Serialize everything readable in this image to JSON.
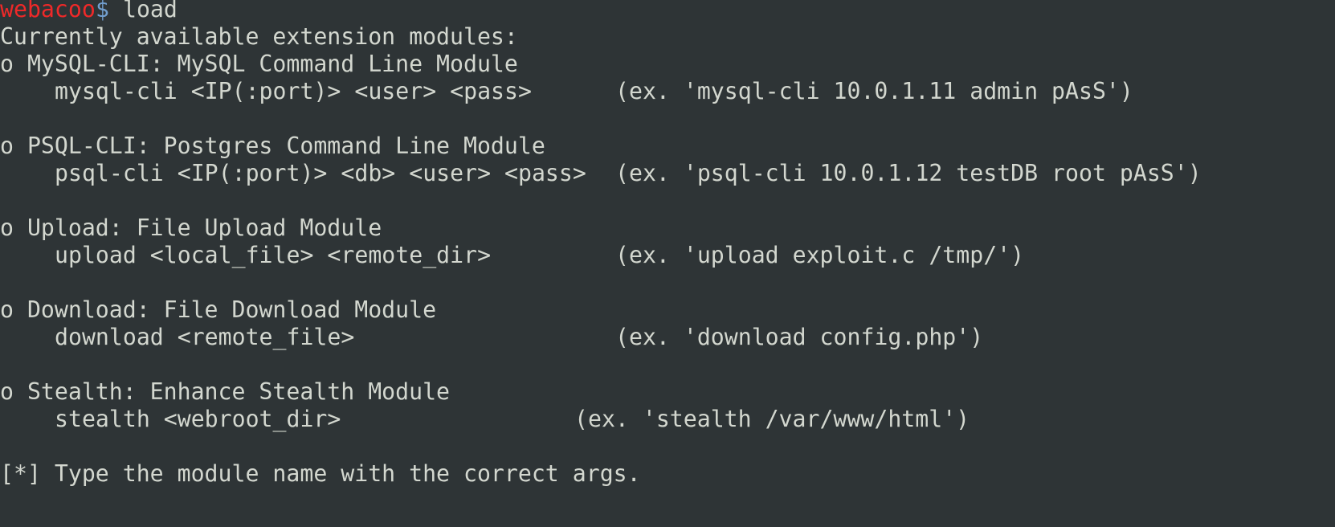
{
  "colors": {
    "background": "#2e3436",
    "foreground": "#d3d7cf",
    "prompt_host": "#ef2929",
    "prompt_symbol": "#729fcf"
  },
  "prompt": {
    "host": "webacoo",
    "symbol": "$",
    "command": " load"
  },
  "header": "Currently available extension modules:",
  "modules": [
    {
      "title": "o MySQL-CLI: MySQL Command Line Module",
      "usage": "mysql-cli <IP(:port)> <user> <pass>",
      "example": "(ex. 'mysql-cli 10.0.1.11 admin pAsS')"
    },
    {
      "title": "o PSQL-CLI: Postgres Command Line Module",
      "usage": "psql-cli <IP(:port)> <db> <user> <pass>",
      "example": "(ex. 'psql-cli 10.0.1.12 testDB root pAsS')"
    },
    {
      "title": "o Upload: File Upload Module",
      "usage": "upload <local_file> <remote_dir>",
      "example": "(ex. 'upload exploit.c /tmp/')"
    },
    {
      "title": "o Download: File Download Module",
      "usage": "download <remote_file>",
      "example": "(ex. 'download config.php')"
    },
    {
      "title": "o Stealth: Enhance Stealth Module",
      "usage": "stealth <webroot_dir>",
      "example": "(ex. 'stealth /var/www/html')"
    }
  ],
  "footer": "[*] Type the module name with the correct args."
}
